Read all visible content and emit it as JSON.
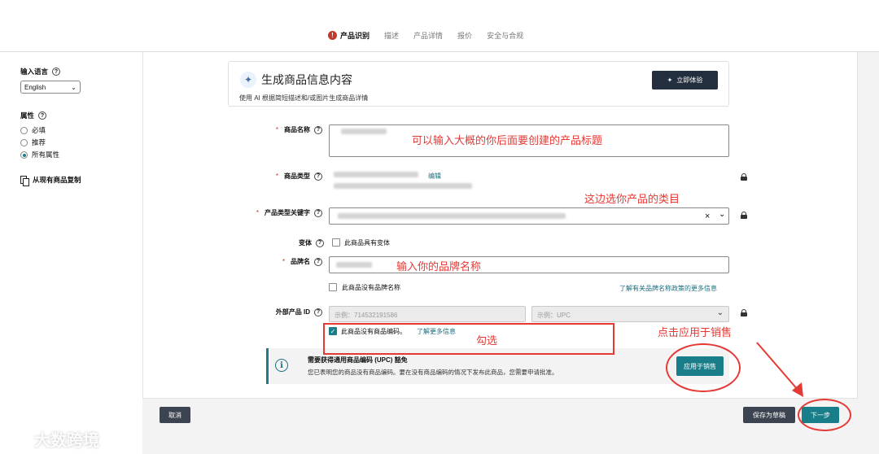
{
  "tabs": [
    {
      "label": "产品识别",
      "active": true,
      "alert": "!"
    },
    {
      "label": "描述"
    },
    {
      "label": "产品详情"
    },
    {
      "label": "报价"
    },
    {
      "label": "安全与合规"
    }
  ],
  "sidebar": {
    "language_label": "输入语言",
    "language_value": "English",
    "attributes_label": "属性",
    "options": [
      "必填",
      "推荐",
      "所有属性"
    ],
    "selected_option": "所有属性",
    "copy_label": "从现有商品复制"
  },
  "ai_card": {
    "title": "生成商品信息内容",
    "subtitle": "使用 AI 根据简短描述和/或图片生成商品详情",
    "button": "立即体验"
  },
  "form": {
    "required_mark": "*",
    "product_name_label": "商品名称",
    "product_type_label": "商品类型",
    "edit_link": "编辑",
    "keyword_label": "产品类型关键字",
    "clear_symbol": "×",
    "variation_label": "变体",
    "variation_checkbox": "此商品具有变体",
    "brand_label": "品牌名",
    "no_brand_checkbox": "此商品没有品牌名称",
    "brand_policy_link": "了解有关品牌名称政策的更多信息",
    "external_id_label": "外部产品 ID",
    "external_id_placeholder": "示例：714532191586",
    "id_type_placeholder": "示例：UPC",
    "no_code_checkbox": "此商品没有商品编码。",
    "learn_more_link": "了解更多信息"
  },
  "notice": {
    "title": "需要获得通用商品编码 (UPC) 豁免",
    "body": "您已表明您的商品没有商品编码。要在没有商品编码的情况下发布此商品，您需要申请批准。",
    "button": "应用于销售"
  },
  "footer": {
    "cancel": "取消",
    "save_draft": "保存为草稿",
    "next": "下一步"
  },
  "annotations": {
    "title_hint": "可以输入大概的你后面要创建的产品标题",
    "category_hint": "这边选你产品的类目",
    "brand_hint": "输入你的品牌名称",
    "check_hint": "勾选",
    "apply_hint": "点击应用于销售"
  },
  "watermark": "大数跨境",
  "colors": {
    "accent": "#1a7e8a",
    "annotation": "#e53935",
    "dark_button": "#3d4451"
  }
}
